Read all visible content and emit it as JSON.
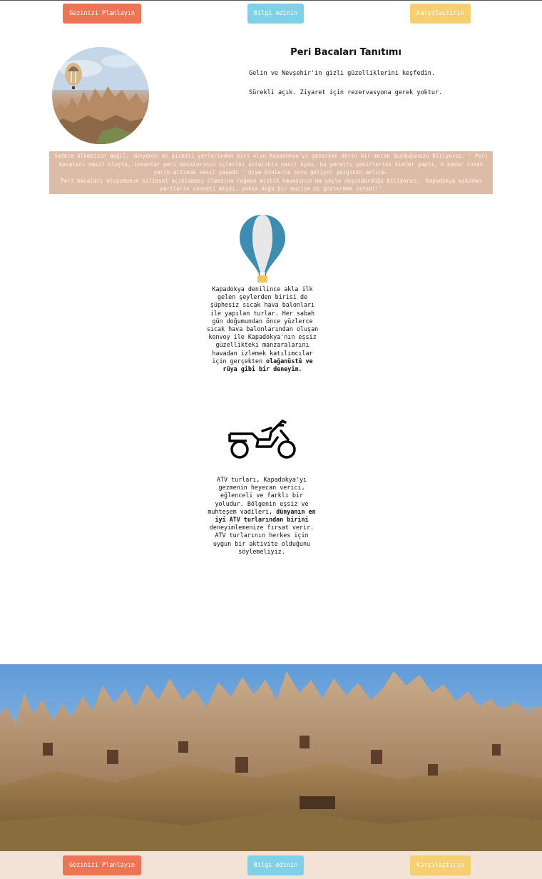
{
  "nav": {
    "plan_label": "Gezinizi Planlayın",
    "info_label": "Bilgi edinin",
    "compare_label": "Karşılaştırın"
  },
  "header": {
    "title": "Peri Bacaları Tanıtımı",
    "paragraph1": "Gelin ve Nevşehir'in gizli güzelliklerini keşfedin.",
    "paragraph2": "Sürekli açık. Ziyaret için rezervasyona gerek yoktur."
  },
  "intro": {
    "line1": "Sadece ülkemizin değil, dünyanın en gizemli yerlerinden biri olan Kapadokya'yı gezerken derin bir merak duyduğunuzu biliyoruz. ' Peri bacaları nasıl oluştu, insanlar peri bacalarının içlerini ustalıkla nasıl oydu, bu yeraltı şehirlerini kimler yaptı, o kadar insan yerin altında nasıl yaşadı ' diye binlerce soru geliyor gezginin aklına.",
    "line2": "Peri bacaları oluşumunun bilimsel açıklaması olmasına rağmen mistik havasının da şöyle düşündürdüğü biliyoruz; 'Kapadokya eskiden perilerin cenneti miydi, yoksa doğa bir mucize mi göstermek istedi!'"
  },
  "balloon_section": {
    "text": "Kapadokya denilince akla ilk gelen şeylerden birisi de şüphesiz sıcak hava balonları ile yapılan turlar. Her sabah gün doğumundan önce yüzlerce sıcak hava balonlarından oluşan konvoy ile Kapadokya'nın eşsiz güzellikteki manzaralarını havadan izlemek katılımcılar için gerçekten",
    "bold": "olağanüstü ve rüya gibi bir deneyim."
  },
  "atv_section": {
    "text_before": "ATV turları, Kapadokya'yı gezmenin heyecan verici, eğlenceli ve farklı bir yoludur. Bölgenin eşsiz ve muhteşem vadileri,",
    "bold": "dünyanın en iyi ATV turlarından birini",
    "text_after": "deneyimlemenize fırsat verir. ATV turlarının herkes için uygun bir aktivite olduğunu söylemeliyiz."
  },
  "footer": {
    "plan_label": "Gezinizi Planlayın",
    "info_label": "Bilgi edinin",
    "compare_label": "Karşılaştırın"
  },
  "icons": {
    "balloon": "hot-air-balloon-icon",
    "atv": "atv-icon"
  },
  "colors": {
    "orange": "#ee7456",
    "blue": "#7ed1e6",
    "yellow": "#f7cf73",
    "intro_bg": "#dcbca7",
    "footer_bg": "#f2e2d8",
    "balloon_blue": "#3d8db3"
  }
}
